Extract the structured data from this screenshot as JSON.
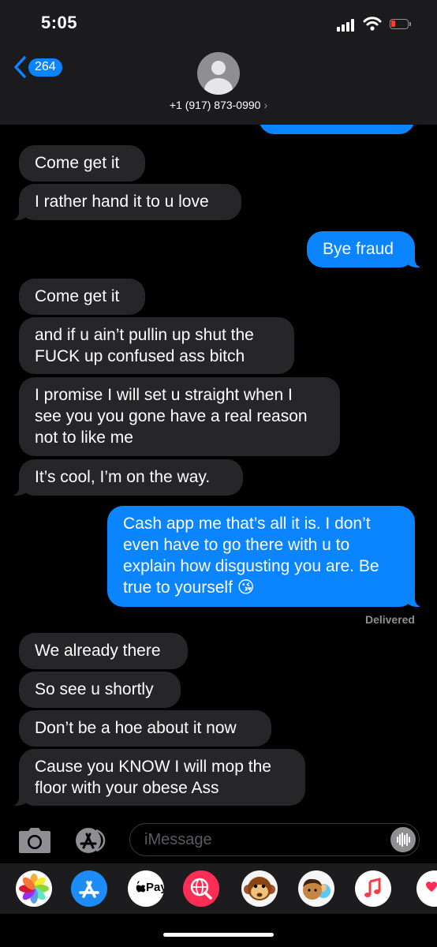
{
  "status": {
    "time": "5:05"
  },
  "header": {
    "back_count": "264",
    "contact": "+1 (917) 873-0990",
    "chevron": "›"
  },
  "messages": [
    {
      "text": "Come get it"
    },
    {
      "text": "I rather hand it to u love"
    },
    {
      "text": "Bye fraud"
    },
    {
      "text": "Come get it"
    },
    {
      "text": "and if u ain’t pullin up shut the\nFUCK up confused ass bitch"
    },
    {
      "text": "I promise I will set u straight when I\nsee you you gone have a real reason\nnot to like me"
    },
    {
      "text": "It’s cool, I’m on the way."
    },
    {
      "text": "Cash app me that’s all it is. I don’t\neven have to go there with u to\nexplain how disgusting you are. Be\ntrue to yourself 😘"
    },
    {
      "text": "We already there"
    },
    {
      "text": "So see u shortly"
    },
    {
      "text": "Don’t be a hoe about it now"
    },
    {
      "text": "Cause you KNOW I will mop the\nfloor with your obese Ass"
    }
  ],
  "delivered": "Delivered",
  "input": {
    "placeholder": "iMessage"
  },
  "apps": [
    {
      "name": "photos-app",
      "icon": "photos-icon"
    },
    {
      "name": "app-store-app",
      "icon": "app-store-icon"
    },
    {
      "name": "apple-pay-app",
      "icon": "apple-pay-icon",
      "label": "Pay"
    },
    {
      "name": "web-images-app",
      "icon": "globe-search-icon"
    },
    {
      "name": "animoji-app",
      "icon": "monkey-icon"
    },
    {
      "name": "memoji-app",
      "icon": "memoji-icon"
    },
    {
      "name": "music-app",
      "icon": "music-note-icon",
      "label": "♫"
    },
    {
      "name": "digital-touch-app",
      "icon": "heart-hand-icon"
    }
  ],
  "colors": {
    "outgoing": "#0a84ff",
    "incoming": "#262628",
    "header": "#1b1b1d"
  }
}
